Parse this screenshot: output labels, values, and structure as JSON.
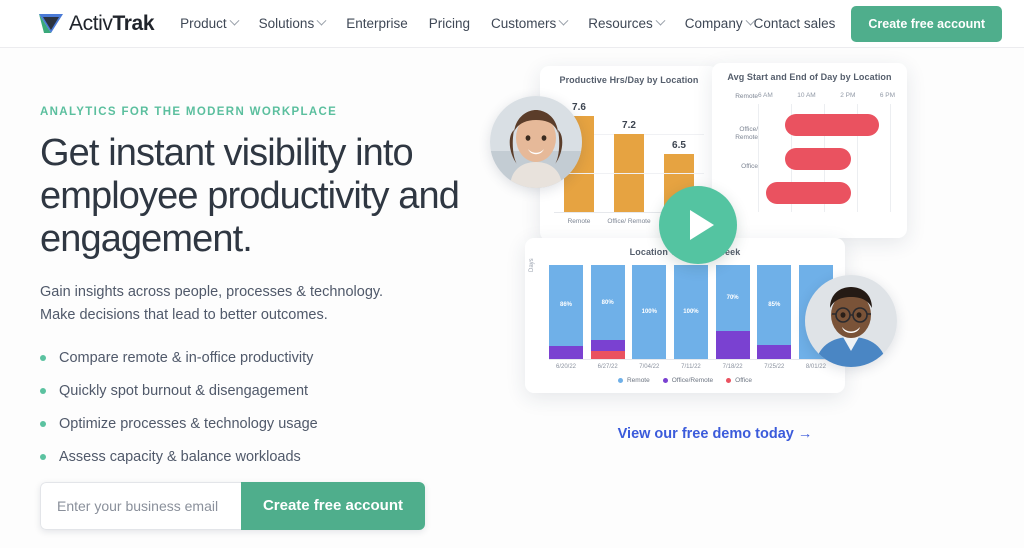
{
  "nav": {
    "logo": {
      "activ": "Activ",
      "trak": "Trak",
      "icon": "activtrak-logo-icon"
    },
    "links": [
      {
        "label": "Product",
        "has_dropdown": true
      },
      {
        "label": "Solutions",
        "has_dropdown": true
      },
      {
        "label": "Enterprise",
        "has_dropdown": false
      },
      {
        "label": "Pricing",
        "has_dropdown": false
      },
      {
        "label": "Customers",
        "has_dropdown": true
      },
      {
        "label": "Resources",
        "has_dropdown": true
      },
      {
        "label": "Company",
        "has_dropdown": true
      }
    ],
    "contact_sales": "Contact sales",
    "cta": "Create free account"
  },
  "hero": {
    "eyebrow": "ANALYTICS FOR THE MODERN WORKPLACE",
    "headline": "Get instant visibility into employee productivity and engagement.",
    "subcopy_line1": "Gain insights across people, processes & technology.",
    "subcopy_line2": "Make decisions that lead to better outcomes.",
    "bullets": [
      "Compare remote & in-office productivity",
      "Quickly spot burnout & disengagement",
      "Optimize processes & technology usage",
      "Assess capacity & balance workloads"
    ],
    "form": {
      "email_placeholder": "Enter your business email",
      "email_value": "",
      "submit_label": "Create free account"
    },
    "demo_link": "View our free demo today →",
    "play_button_label": "play-video"
  },
  "colors": {
    "brand_green": "#4fae8c",
    "accent_green": "#5bc2a0",
    "play_green": "#54c4a1",
    "bar_orange": "#e6a341",
    "bar_blue": "#6fb0e8",
    "bar_purple": "#7a41d1",
    "bar_red": "#ea5260",
    "link_blue": "#3b5bdb",
    "heading": "#2f3742"
  },
  "chart_data": [
    {
      "type": "bar",
      "title": "Productive Hrs/Day by Location",
      "categories": [
        "Remote",
        "Office/ Remote",
        "Office"
      ],
      "values": [
        7.6,
        7.2,
        6.5
      ],
      "value_labels": [
        "7.6",
        "7.2",
        "6.5"
      ],
      "xlabel": "",
      "ylabel": "",
      "ylim": [
        0,
        8
      ],
      "grid": true,
      "legend": "none",
      "color": "#e6a341"
    },
    {
      "type": "bar",
      "orientation": "horizontal-range",
      "title": "Avg Start and End of Day by Location",
      "categories": [
        "Remote",
        "Office/ Remote",
        "Office"
      ],
      "tick_labels": [
        "6 AM",
        "10 AM",
        "2 PM",
        "6 PM"
      ],
      "ranges": [
        {
          "category": "Remote",
          "start": "9 AM",
          "end": "6:30 PM"
        },
        {
          "category": "Office/ Remote",
          "start": "9 AM",
          "end": "3 PM"
        },
        {
          "category": "Office",
          "start": "7:30 AM",
          "end": "3 PM"
        }
      ],
      "grid": true,
      "legend": "none",
      "color": "#ea5260"
    },
    {
      "type": "bar",
      "stacked": true,
      "title": "Location Trends by Week",
      "ylabel": "Days",
      "categories": [
        "6/20/22",
        "6/27/22",
        "7/04/22",
        "7/11/22",
        "7/18/22",
        "7/25/22",
        "8/01/22"
      ],
      "series": [
        {
          "name": "Remote",
          "color": "#6fb0e8",
          "values": [
            86,
            80,
            100,
            100,
            70,
            85,
            100
          ]
        },
        {
          "name": "Office/Remote",
          "color": "#7a41d1",
          "values": [
            14,
            12,
            0,
            0,
            30,
            15,
            0
          ]
        },
        {
          "name": "Office",
          "color": "#ea5260",
          "values": [
            0,
            8,
            0,
            0,
            0,
            0,
            0
          ]
        }
      ],
      "segment_labels": [
        "86%",
        "80%",
        "100%",
        "100%",
        "70%",
        "85%",
        ""
      ],
      "ylim": [
        0,
        100
      ],
      "legend": "bottom",
      "legend_entries": [
        "Remote",
        "Office/Remote",
        "Office"
      ]
    }
  ]
}
